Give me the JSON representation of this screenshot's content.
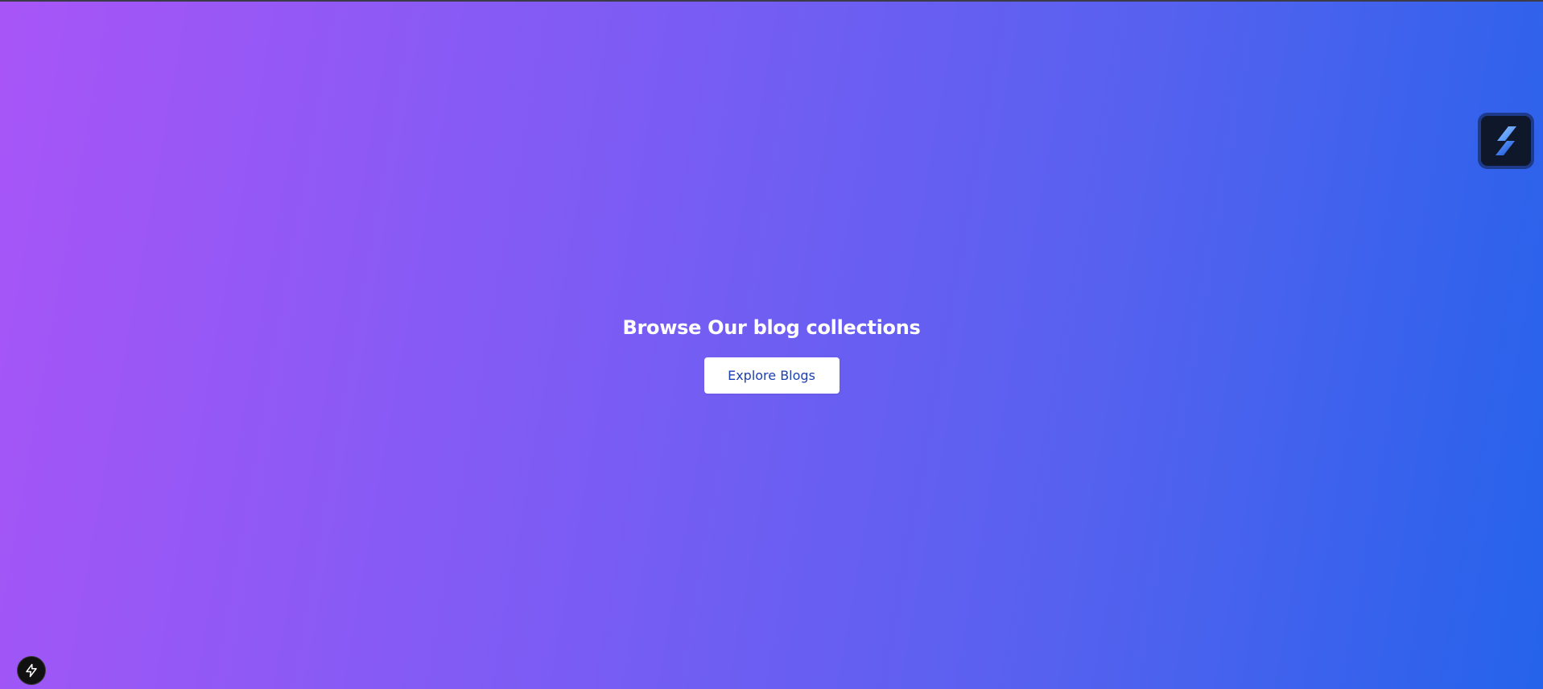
{
  "hero": {
    "title": "Browse Our blog collections",
    "button_label": "Explore Blogs"
  },
  "widgets": {
    "app_logo_icon": "stacked-bars-logo-icon",
    "dev_badge_icon": "lightning-bolt-icon"
  },
  "colors": {
    "gradient_start": "#a855f7",
    "gradient_end": "#2563eb",
    "button_text": "#1e40af",
    "button_bg": "#ffffff",
    "title_text": "#ffffff"
  }
}
